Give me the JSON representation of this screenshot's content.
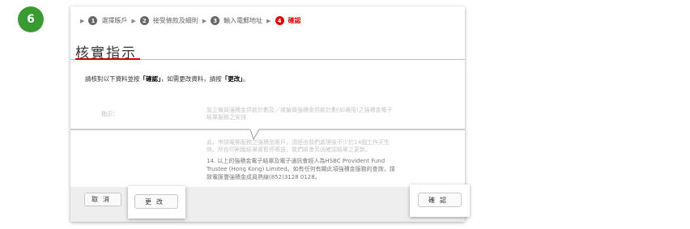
{
  "badge": "6",
  "steps": [
    {
      "num": "1",
      "label": "選擇賬戶",
      "active": false
    },
    {
      "num": "2",
      "label": "接受條款及細則",
      "active": false
    },
    {
      "num": "3",
      "label": "輸入電郵地址",
      "active": false
    },
    {
      "num": "4",
      "label": "確認",
      "active": true
    }
  ],
  "title": "核實指示",
  "instruction": {
    "prefix": "請核對以下資料並按",
    "confirm": "「確認」",
    "middle": "，如需更改資料，請按",
    "change": "「更改」",
    "suffix": "。"
  },
  "details": {
    "label": "指示：",
    "faded_lines": [
      "設立僱員強積金供款計劃及／或僱員強積金供款計劃(如適用)之強積金電子",
      "結單服務之安排",
      "此，申請電郵服務之強積金賬戶，須經由我們處理後不少於14個工作天生",
      "效。所在印刷版結單將暫停寄送，我們將會另函確認結單之更新。"
    ],
    "fine_lines": [
      "14. 以上的強積金電子結單及電子通訊會經人為HSBC Provident Fund",
      "Trustee (Hong Kong) Limited。如有任何有關此項強積金服務的查詢，請",
      "致電匯豐強積金成員熱線(852)3128 0128。"
    ]
  },
  "buttons": {
    "cancel": "取消",
    "change": "更改",
    "confirm": "確認"
  }
}
